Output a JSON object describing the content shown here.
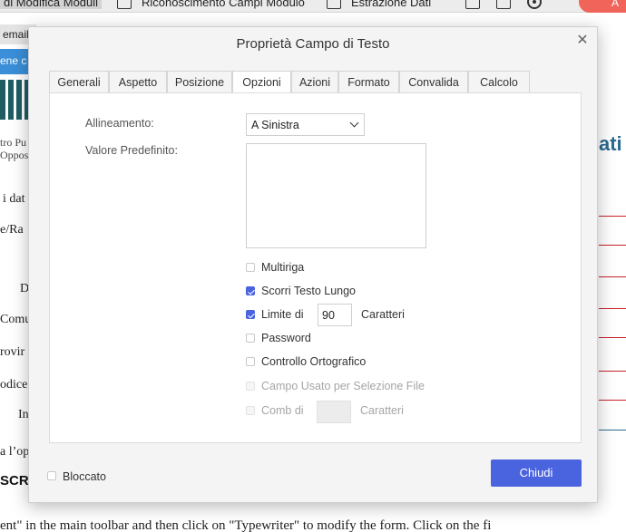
{
  "background": {
    "toolbar": {
      "items": [
        "di Modifica Moduli",
        "Riconoscimento Campi Modulo",
        "Estrazione Dati"
      ],
      "action_button": "A"
    },
    "document": {
      "tab_label": "email",
      "bar_text": "ene c",
      "logo_text": [
        "tro Pu",
        "Oppos"
      ],
      "labels": [
        "i dat",
        "e/Ra",
        "D",
        "Comu",
        "rovir",
        "odice",
        "In",
        "a l’op"
      ],
      "section_title": "SCRI",
      "right_heading": "ati",
      "bottom_text": "ent\" in the main toolbar and then click on \"Typewriter\" to modify the form. Click on the fi"
    }
  },
  "dialog": {
    "title": "Proprietà Campo di Testo",
    "close_icon": "close-icon",
    "tabs": [
      {
        "label": "Generali",
        "active": false
      },
      {
        "label": "Aspetto",
        "active": false
      },
      {
        "label": "Posizione",
        "active": false
      },
      {
        "label": "Opzioni",
        "active": true
      },
      {
        "label": "Azioni",
        "active": false
      },
      {
        "label": "Formato",
        "active": false
      },
      {
        "label": "Convalida",
        "active": false
      },
      {
        "label": "Calcolo",
        "active": false
      }
    ],
    "options": {
      "alignment_label": "Allineamento:",
      "alignment_value": "A Sinistra",
      "default_value_label": "Valore Predefinito:",
      "default_value": "",
      "multiline": {
        "label": "Multiriga",
        "checked": false,
        "enabled": true
      },
      "scroll_long_text": {
        "label": "Scorri Testo Lungo",
        "checked": true,
        "enabled": true
      },
      "limit": {
        "label": "Limite di",
        "value": "90",
        "suffix": "Caratteri",
        "checked": true,
        "enabled": true
      },
      "password": {
        "label": "Password",
        "checked": false,
        "enabled": true
      },
      "spell_check": {
        "label": "Controllo Ortografico",
        "checked": false,
        "enabled": true
      },
      "file_select": {
        "label": "Campo Usato per Selezione File",
        "checked": false,
        "enabled": false
      },
      "comb": {
        "label": "Comb di",
        "value": "",
        "suffix": "Caratteri",
        "checked": false,
        "enabled": false
      }
    },
    "footer": {
      "locked_label": "Bloccato",
      "locked": false,
      "close_button": "Chiudi"
    },
    "accent_color": "#4a63df"
  }
}
